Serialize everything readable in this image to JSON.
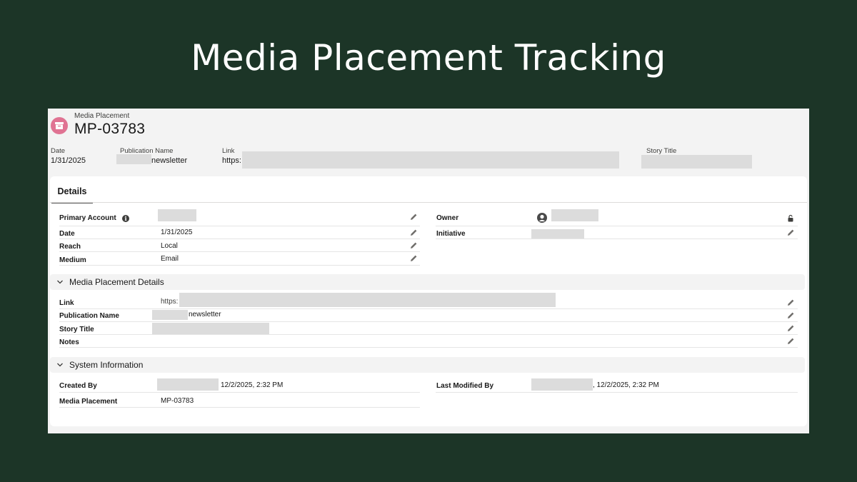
{
  "slide": {
    "title": "Media Placement Tracking"
  },
  "record": {
    "object_label": "Media Placement",
    "name": "MP-03783"
  },
  "highlights": {
    "date_label": "Date",
    "date_value": "1/31/2025",
    "publication_label": "Publication Name",
    "publication_value": "newsletter",
    "link_label": "Link",
    "link_value": "https:",
    "story_label": "Story Title"
  },
  "tabs": {
    "details": "Details"
  },
  "details": {
    "primary_account_label": "Primary Account",
    "date_label": "Date",
    "date_value": "1/31/2025",
    "reach_label": "Reach",
    "reach_value": "Local",
    "medium_label": "Medium",
    "medium_value": "Email",
    "owner_label": "Owner",
    "initiative_label": "Initiative"
  },
  "media_section": {
    "title": "Media Placement Details",
    "link_label": "Link",
    "link_value": "https:",
    "publication_label": "Publication Name",
    "publication_value": "newsletter",
    "story_label": "Story Title",
    "notes_label": "Notes"
  },
  "system_section": {
    "title": "System Information",
    "created_by_label": "Created By",
    "created_by_value": "12/2/2025, 2:32 PM",
    "last_modified_label": "Last Modified By",
    "last_modified_value": ", 12/2/2025, 2:32 PM",
    "placement_label": "Media Placement",
    "placement_value": "MP-03783"
  },
  "colors": {
    "background": "#1c3527",
    "record_icon": "#e07393",
    "redaction": "#dcdcdc"
  },
  "icons": [
    "archive-icon",
    "info-icon",
    "pencil-icon",
    "avatar-icon",
    "change-owner-icon",
    "chevron-down-icon"
  ]
}
